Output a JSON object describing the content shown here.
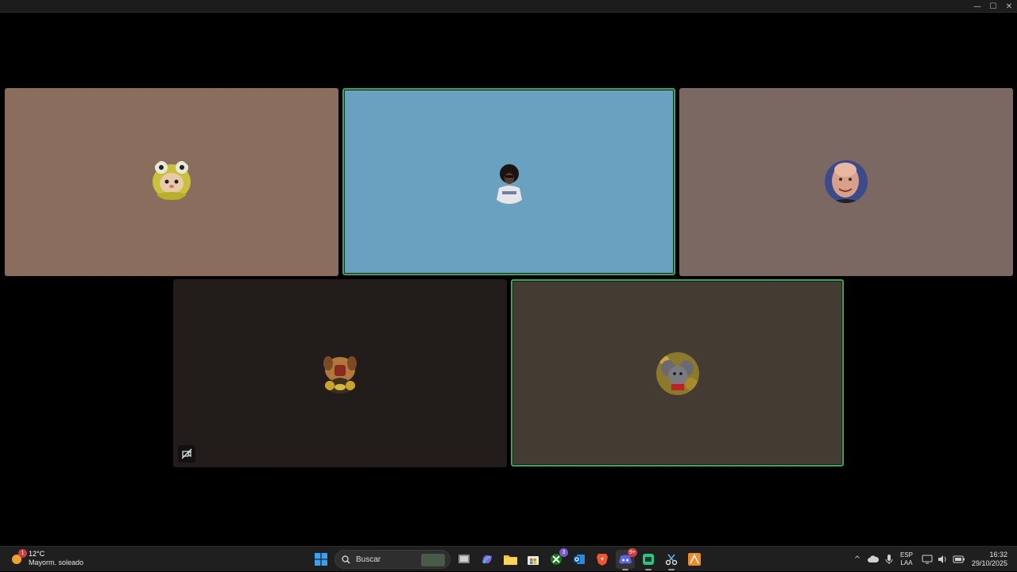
{
  "window": {
    "controls": [
      {
        "name": "minimize-button",
        "glyph": "—"
      },
      {
        "name": "maximize-button",
        "glyph": "☐"
      },
      {
        "name": "close-button",
        "glyph": "✕"
      }
    ]
  },
  "call": {
    "tiles": [
      {
        "avatar": "frog-hat-cat-avatar",
        "bg": "#8b6d5d",
        "speaking": false,
        "muted": false
      },
      {
        "avatar": "afro-person-avatar",
        "bg": "#6aa0c0",
        "speaking": true,
        "muted": false
      },
      {
        "avatar": "bald-man-avatar",
        "bg": "#7c6862",
        "speaking": false,
        "muted": false
      },
      {
        "avatar": "armored-dog-avatar",
        "bg": "#221c1b",
        "speaking": false,
        "muted": true
      },
      {
        "avatar": "gray-mouse-avatar",
        "bg": "#443b33",
        "speaking": true,
        "muted": false
      }
    ],
    "speaking_color": "#3ba55c"
  },
  "taskbar": {
    "weather": {
      "temp": "12°C",
      "condition": "Mayorm. soleado",
      "badge": "1"
    },
    "search": {
      "label": "Buscar"
    },
    "apps": [
      {
        "name": "start-button",
        "icon": "windows-logo-icon"
      },
      {
        "name": "search-box",
        "icon": "search-icon"
      },
      {
        "name": "task-view-button",
        "icon": "task-view-icon"
      },
      {
        "name": "copilot-button",
        "icon": "copilot-icon"
      },
      {
        "name": "file-explorer-button",
        "icon": "folder-icon"
      },
      {
        "name": "store-button",
        "icon": "store-icon"
      },
      {
        "name": "xbox-button",
        "icon": "xbox-icon",
        "badge": "3"
      },
      {
        "name": "outlook-button",
        "icon": "outlook-icon"
      },
      {
        "name": "brave-button",
        "icon": "brave-icon"
      },
      {
        "name": "discord-button",
        "icon": "discord-icon",
        "badge": "9+"
      },
      {
        "name": "teams-button",
        "icon": "app-icon"
      },
      {
        "name": "snipping-button",
        "icon": "scissors-icon"
      },
      {
        "name": "adobe-button",
        "icon": "adobe-icon"
      }
    ],
    "tray": {
      "chevron": "^",
      "lang_top": "ESP",
      "lang_bottom": "LAA",
      "time": "16:32",
      "date": "29/10/2025"
    }
  }
}
